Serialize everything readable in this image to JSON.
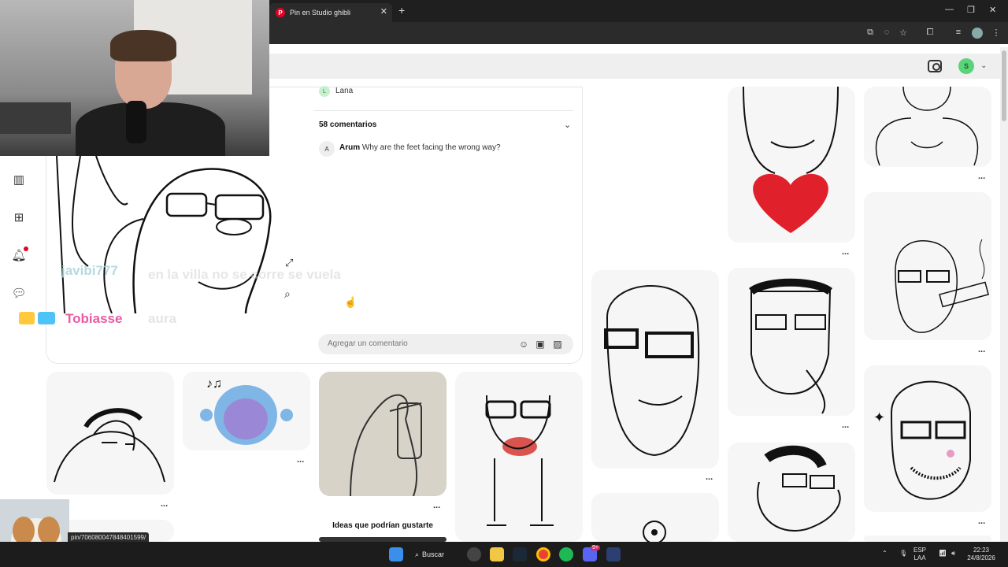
{
  "browser": {
    "tab_title": "Pin en Studio ghibli",
    "new_tab": "+",
    "close": "✕",
    "minimize": "—",
    "maximize": "❐",
    "close_window": "✕"
  },
  "header": {
    "avatar_initial": "S"
  },
  "pin": {
    "author_initial": "L",
    "author_name": "Lana",
    "comments_title": "58 comentarios",
    "comment": {
      "initial": "A",
      "author": "Arum",
      "text": "Why are the feet facing the wrong way?"
    },
    "input_placeholder": "Agregar un comentario"
  },
  "chat": [
    {
      "user": "javibi777",
      "message": "en la villa no se corre se vuela"
    },
    {
      "user": "Tobiasse",
      "message": "aura"
    }
  ],
  "grid": {
    "section_title": "Ideas que podrían gustarte",
    "more_label": "..."
  },
  "status_url": "pin/706080047848401599/",
  "taskbar": {
    "search_label": "Buscar",
    "lang_top": "ESP",
    "lang_bottom": "LAA",
    "time": "22:23",
    "date": "24/8/2026",
    "discord_badge": "9+"
  },
  "colors": {
    "pinterest_red": "#e60023",
    "chat_name_pink": "#e85aa4",
    "chat_name_cyan": "#aad2dc",
    "avatar_green": "#5ad37a"
  },
  "icons": [
    "search-icon",
    "camera-lens-icon",
    "bell-icon",
    "plus-icon",
    "layout-icon",
    "chat-icon",
    "emoji-icon",
    "sticker-icon",
    "image-icon",
    "expand-icon",
    "visual-search-icon",
    "chevron-down-icon"
  ]
}
